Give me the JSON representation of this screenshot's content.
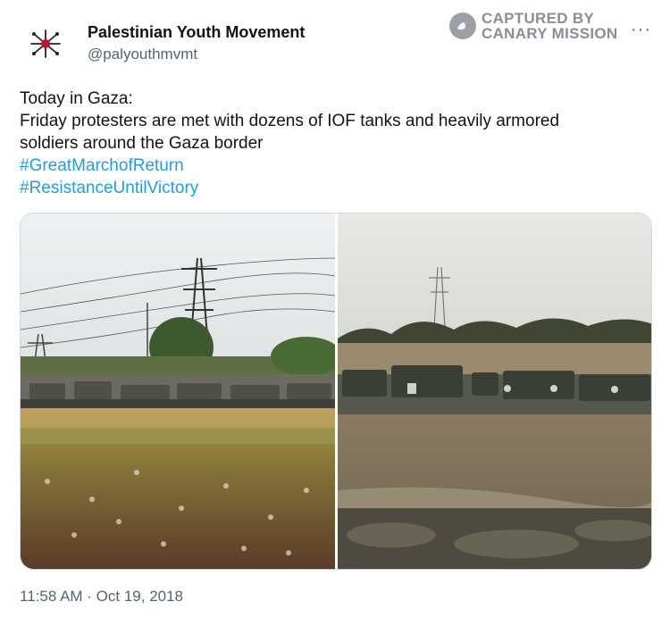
{
  "author": {
    "display_name": "Palestinian Youth Movement",
    "handle": "@palyouthmvmt",
    "avatar_icon": "pym-logo-icon"
  },
  "watermark": {
    "line1": "CAPTURED BY",
    "line2": "CANARY MISSION",
    "icon": "canary-mission-badge-icon"
  },
  "more_icon": "···",
  "tweet": {
    "line1": "Today in Gaza:",
    "line2": "Friday protesters are met with dozens of IOF tanks and heavily armored",
    "line3": "soldiers around the Gaza border",
    "hashtag1": "#GreatMarchofReturn",
    "hashtag2": "#ResistanceUntilVictory"
  },
  "media": {
    "photo_left": "field-with-tanks-photo",
    "photo_right": "tanks-near-border-photo"
  },
  "timestamp": "11:58 AM · Oct 19, 2018",
  "colors": {
    "text": "#0f1419",
    "secondary": "#536471",
    "link": "#1d9bf0",
    "watermark": "#8a8f94"
  }
}
